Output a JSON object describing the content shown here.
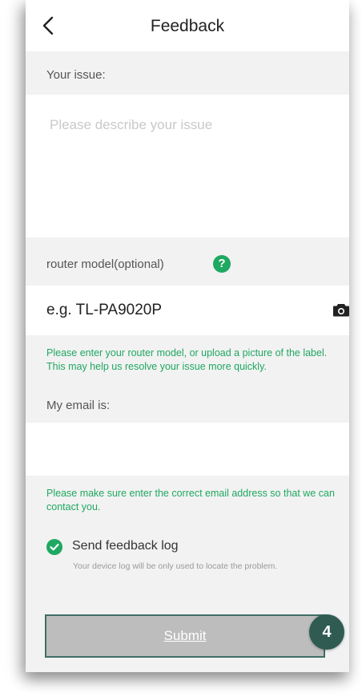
{
  "header": {
    "title": "Feedback",
    "back_icon": "chevron-left-icon"
  },
  "issue": {
    "label": "Your issue:",
    "placeholder": "Please describe your issue",
    "value": ""
  },
  "router_model": {
    "label": "router model(optional)",
    "help_icon": "question-circle-icon",
    "help_glyph": "?",
    "placeholder": "e.g. TL-PA9020P",
    "camera_icon": "camera-icon",
    "hint": "Please enter your router model, or upload a picture of the label. This may help us resolve your issue more quickly."
  },
  "email": {
    "label": "My email is:",
    "value": "",
    "hint": "Please make sure enter the correct email address so that we can contact you."
  },
  "feedback_log": {
    "checked": true,
    "label": "Send feedback log",
    "description": "Your device log will be only used to locate the problem."
  },
  "submit": {
    "label": "Submit",
    "step_badge": "4"
  },
  "colors": {
    "accent": "#1fa861",
    "badge": "#2f5b52",
    "button_disabled": "#bdbdbd",
    "background": "#f2f2f2"
  }
}
